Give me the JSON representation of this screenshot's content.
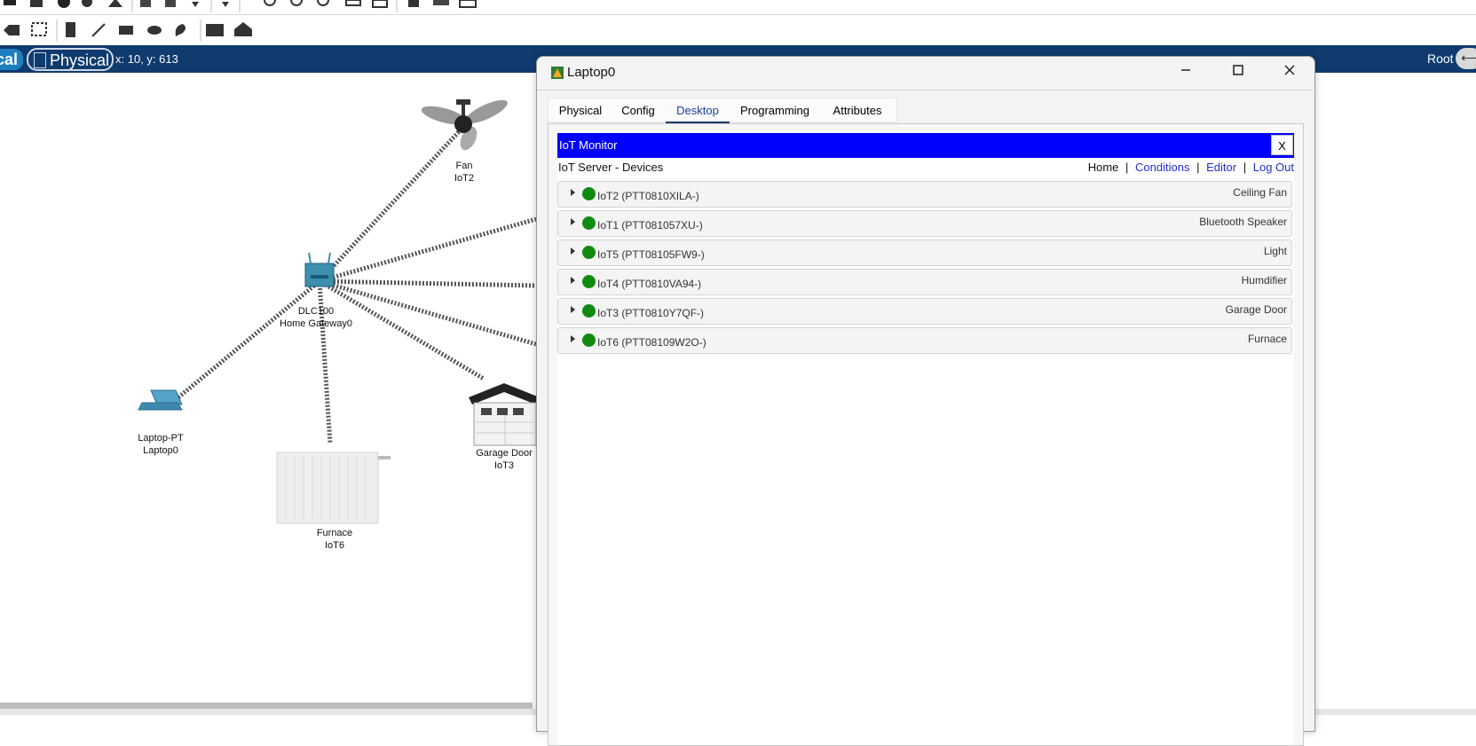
{
  "bluebar": {
    "logical_label": "cal",
    "physical_label": "Physical",
    "coords": "x: 10, y: 613",
    "root_label": "Root"
  },
  "devices": {
    "fan": {
      "line1": "Fan",
      "line2": "IoT2"
    },
    "gateway": {
      "line1": "DLC100",
      "line2": "Home Gateway0"
    },
    "laptop": {
      "line1": "Laptop-PT",
      "line2": "Laptop0"
    },
    "furnace": {
      "line1": "Furnace",
      "line2": "IoT6"
    },
    "garage": {
      "line1": "Garage Door",
      "line2": "IoT3"
    }
  },
  "dialog": {
    "title": "Laptop0",
    "minimize_icon": "minimize-icon",
    "maximize_icon": "maximize-icon",
    "close_icon": "close-icon",
    "tabs": [
      "Physical",
      "Config",
      "Desktop",
      "Programming",
      "Attributes"
    ],
    "active_tab": "Desktop"
  },
  "iot_monitor": {
    "title": "IoT Monitor",
    "close_label": "X",
    "subtitle": "IoT Server - Devices",
    "nav": {
      "home": "Home",
      "conditions": "Conditions",
      "editor": "Editor",
      "logout": "Log Out",
      "sep": "|"
    },
    "devices": [
      {
        "name": "IoT2 (PTT0810XILA-)",
        "type": "Ceiling Fan",
        "status": "green"
      },
      {
        "name": "IoT1 (PTT081057XU-)",
        "type": "Bluetooth Speaker",
        "status": "green"
      },
      {
        "name": "IoT5 (PTT08105FW9-)",
        "type": "Light",
        "status": "green"
      },
      {
        "name": "IoT4 (PTT0810VA94-)",
        "type": "Humdifier",
        "status": "green"
      },
      {
        "name": "IoT3 (PTT0810Y7QF-)",
        "type": "Garage Door",
        "status": "green"
      },
      {
        "name": "IoT6 (PTT08109W2O-)",
        "type": "Furnace",
        "status": "green"
      }
    ]
  },
  "colors": {
    "bluebar": "#0f3b6e",
    "iot_header": "#0000ff",
    "status_green": "#118a11",
    "link_blue": "#2030c8"
  }
}
